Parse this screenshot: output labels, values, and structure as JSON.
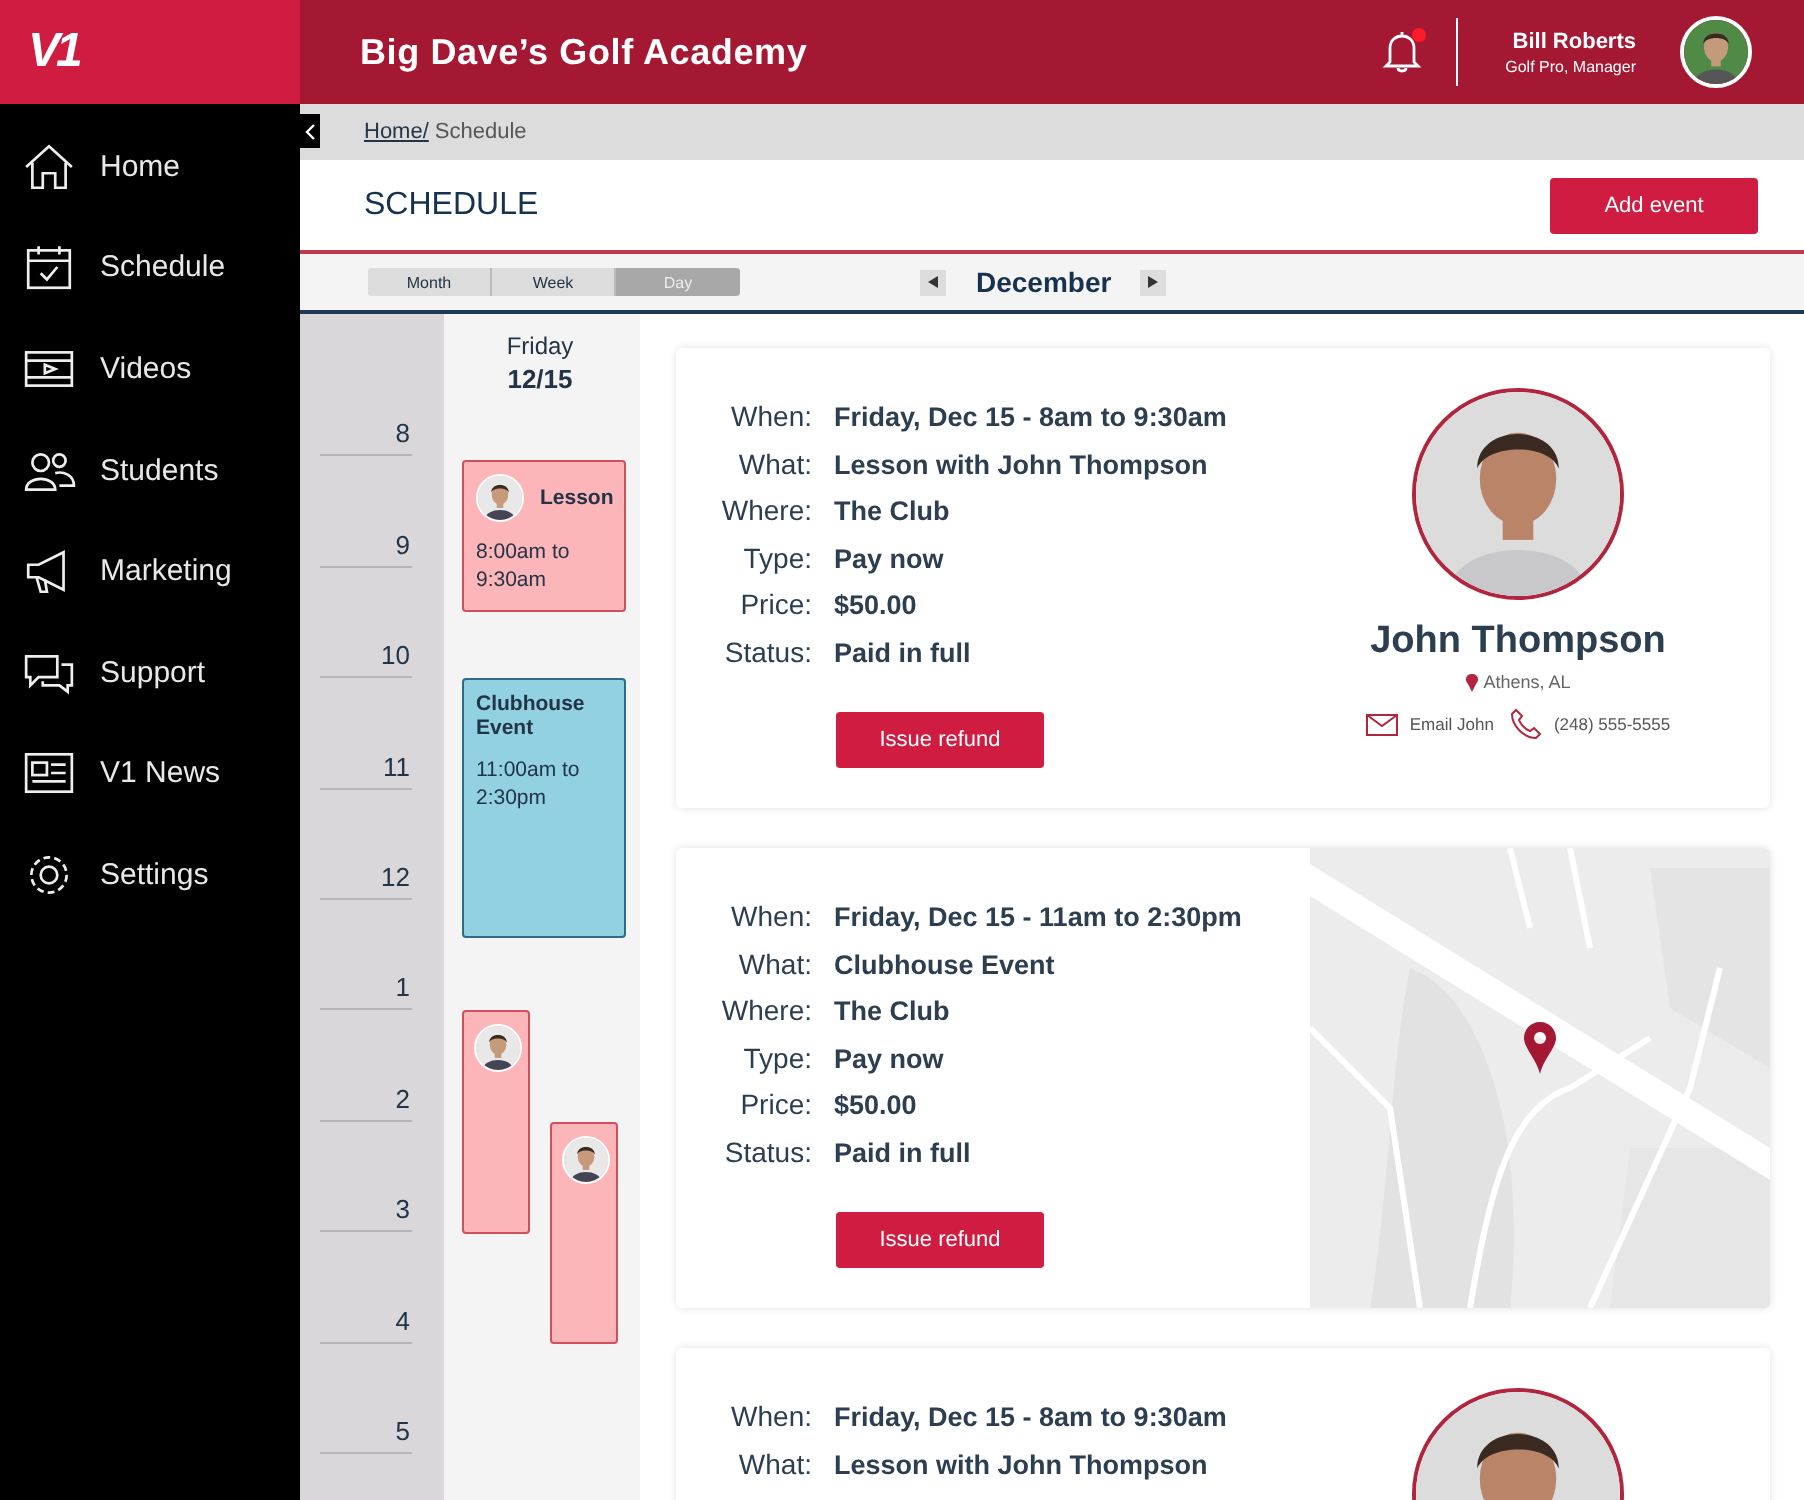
{
  "brand": {
    "logo": "V1"
  },
  "sidebar": {
    "items": [
      {
        "label": "Home"
      },
      {
        "label": "Schedule"
      },
      {
        "label": "Videos"
      },
      {
        "label": "Students"
      },
      {
        "label": "Marketing"
      },
      {
        "label": "Support"
      },
      {
        "label": "V1 News"
      },
      {
        "label": "Settings"
      }
    ]
  },
  "header": {
    "title": "Big Dave’s Golf Academy",
    "notifications_unread": true,
    "user": {
      "name": "Bill Roberts",
      "role": "Golf Pro, Manager"
    }
  },
  "breadcrumb": {
    "link": "Home/",
    "current": "Schedule"
  },
  "page": {
    "title": "SCHEDULE",
    "add_button": "Add event"
  },
  "view_tabs": [
    {
      "label": "Month",
      "selected": false
    },
    {
      "label": "Week",
      "selected": false
    },
    {
      "label": "Day",
      "selected": true
    }
  ],
  "month": "December",
  "day": {
    "weekday": "Friday",
    "date": "12/15"
  },
  "hours": [
    "8",
    "9",
    "10",
    "11",
    "12",
    "1",
    "2",
    "3",
    "4",
    "5"
  ],
  "events": [
    {
      "kind": "lesson",
      "title": "Lesson",
      "time": "8:00am to 9:30am"
    },
    {
      "kind": "event",
      "title": "Clubhouse Event",
      "time": "11:00am to 2:30pm"
    },
    {
      "kind": "lesson"
    },
    {
      "kind": "lesson"
    }
  ],
  "cards": [
    {
      "details": [
        {
          "label": "When:",
          "value": "Friday, Dec 15 - 8am to 9:30am"
        },
        {
          "label": "What:",
          "value": "Lesson with John Thompson"
        },
        {
          "label": "Where:",
          "value": "The Club"
        },
        {
          "label": "Type:",
          "value": "Pay now"
        },
        {
          "label": "Price:",
          "value": "$50.00"
        },
        {
          "label": "Status:",
          "value": "Paid in full"
        }
      ],
      "refund_button": "Issue refund",
      "side": {
        "kind": "profile",
        "name": "John Thompson",
        "location": "Athens, AL",
        "email": "Email John",
        "phone": "(248) 555-5555"
      }
    },
    {
      "details": [
        {
          "label": "When:",
          "value": "Friday, Dec 15 - 11am to 2:30pm"
        },
        {
          "label": "What:",
          "value": "Clubhouse Event"
        },
        {
          "label": "Where:",
          "value": "The Club"
        },
        {
          "label": "Type:",
          "value": "Pay now"
        },
        {
          "label": "Price:",
          "value": "$50.00"
        },
        {
          "label": "Status:",
          "value": "Paid in full"
        }
      ],
      "refund_button": "Issue refund",
      "side": {
        "kind": "map"
      }
    },
    {
      "details": [
        {
          "label": "When:",
          "value": "Friday, Dec 15 - 8am to 9:30am"
        },
        {
          "label": "What:",
          "value": "Lesson with John Thompson"
        }
      ],
      "side": {
        "kind": "profile"
      }
    }
  ]
}
